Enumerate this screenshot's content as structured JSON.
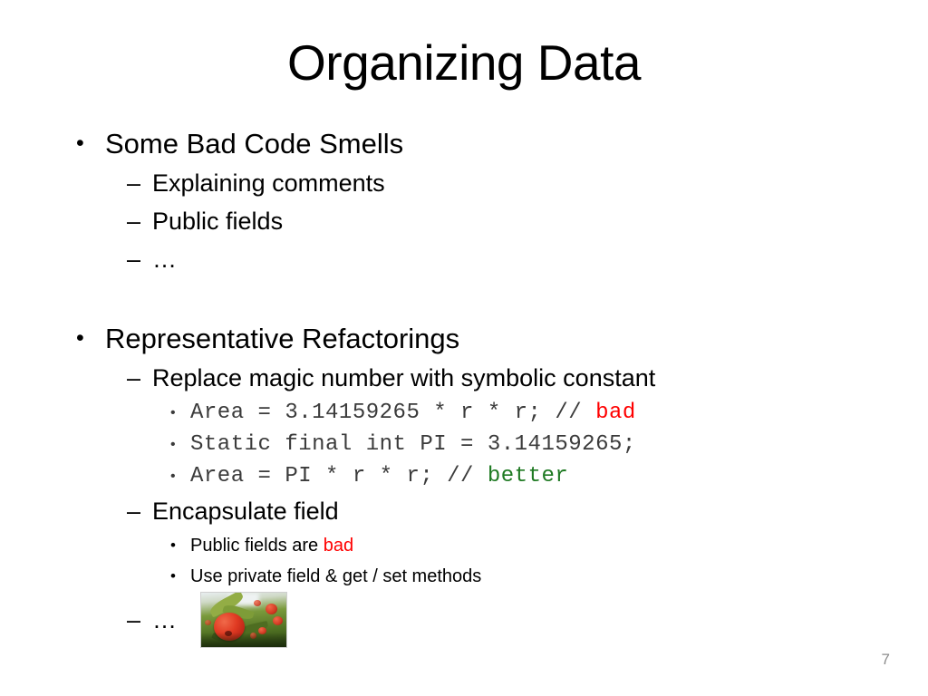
{
  "slide": {
    "title": "Organizing Data",
    "page_number": "7",
    "colors": {
      "background": "#ffffff",
      "text": "#000000",
      "code_text": "#3b3b3b",
      "bad": "#ff0000",
      "better": "#1f7a23",
      "page_number": "#8c8c8c"
    },
    "markers": {
      "level1": "•",
      "level2": "–",
      "level3": "•"
    },
    "sections": [
      {
        "heading": "Some Bad Code Smells",
        "items": [
          {
            "text": "Explaining comments"
          },
          {
            "text": "Public fields"
          },
          {
            "text": "…"
          }
        ]
      },
      {
        "heading": "Representative Refactorings",
        "items": [
          {
            "text": "Replace magic number with symbolic constant",
            "code_lines": [
              {
                "code": "Area = 3.14159265 * r * r; // ",
                "comment": "bad",
                "comment_color": "#ff0000"
              },
              {
                "code": "Static final int PI = 3.14159265;",
                "comment": "",
                "comment_color": ""
              },
              {
                "code": "Area = PI * r * r; // ",
                "comment": "better",
                "comment_color": "#1f7a23"
              }
            ]
          },
          {
            "text": "Encapsulate field",
            "sub_items": [
              {
                "prefix": "Public fields are ",
                "highlight": "bad",
                "highlight_color": "#ff0000",
                "suffix": ""
              },
              {
                "prefix": "Use private field & get / set methods",
                "highlight": "",
                "highlight_color": "",
                "suffix": ""
              }
            ]
          },
          {
            "text": "…",
            "image": {
              "alt": "apple-on-tree-photo"
            }
          }
        ]
      }
    ]
  }
}
